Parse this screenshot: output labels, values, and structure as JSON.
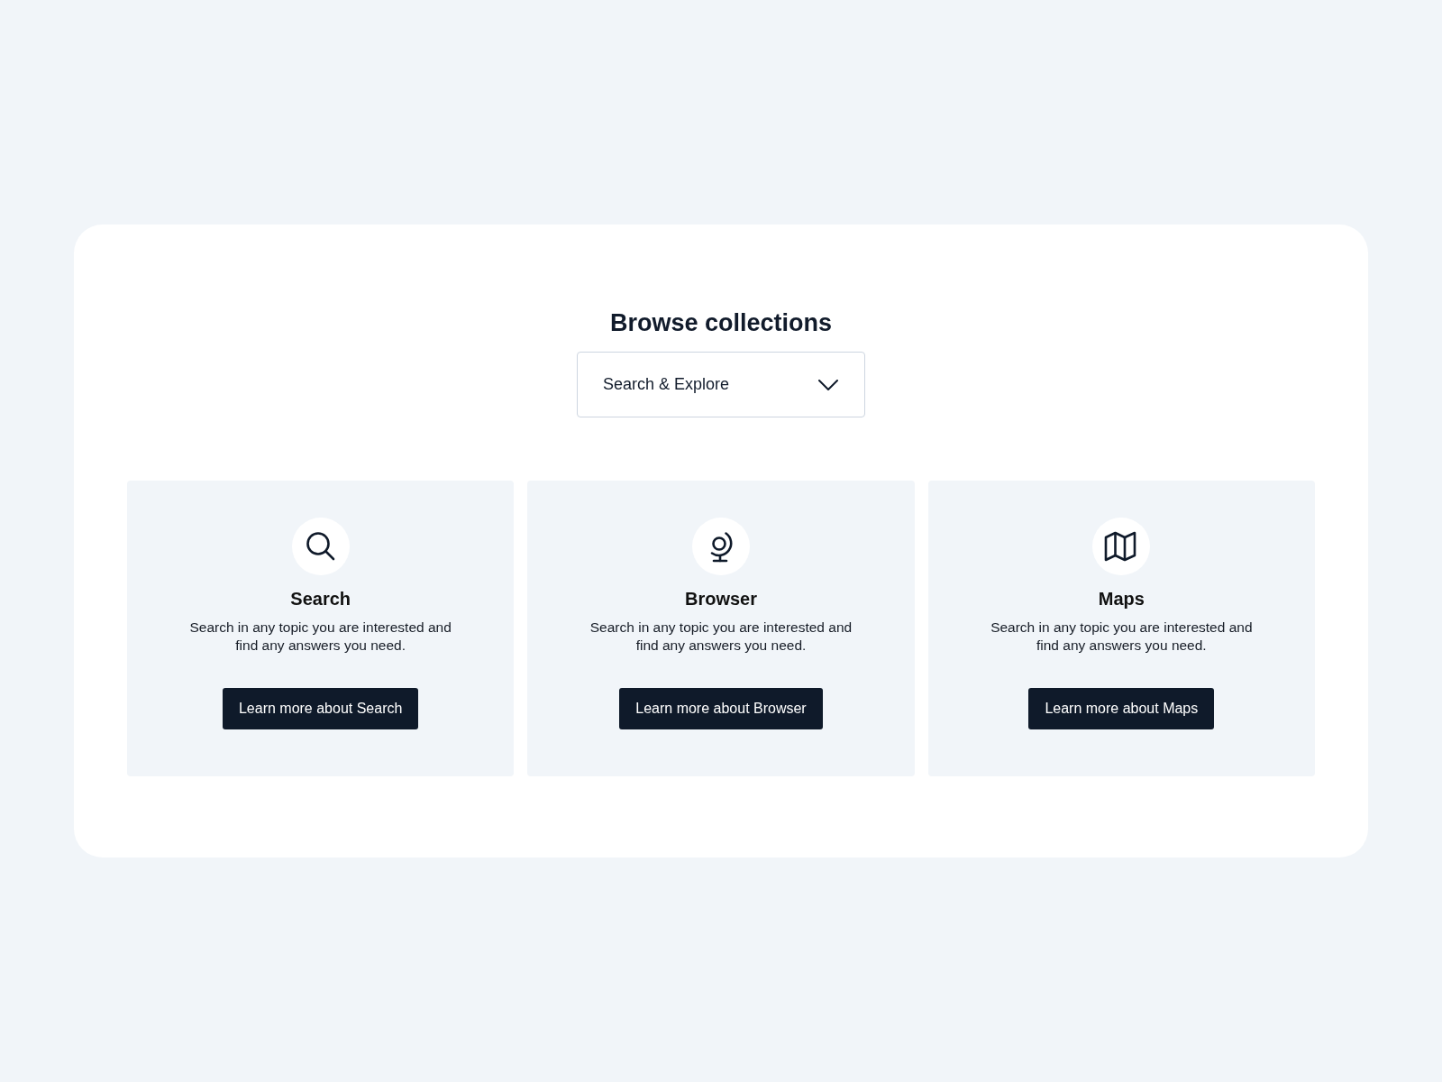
{
  "heading": "Browse collections",
  "dropdown": {
    "value": "Search & Explore"
  },
  "cards": [
    {
      "kind": "search",
      "title": "Search",
      "description": "Search in any topic you are interested and find any answers you need.",
      "button": "Learn more about Search"
    },
    {
      "kind": "browser",
      "title": "Browser",
      "description": "Search in any topic you are interested and find any answers you need.",
      "button": "Learn more about Browser"
    },
    {
      "kind": "maps",
      "title": "Maps",
      "description": "Search in any topic you are interested and find any answers you need.",
      "button": "Learn more about Maps"
    }
  ]
}
